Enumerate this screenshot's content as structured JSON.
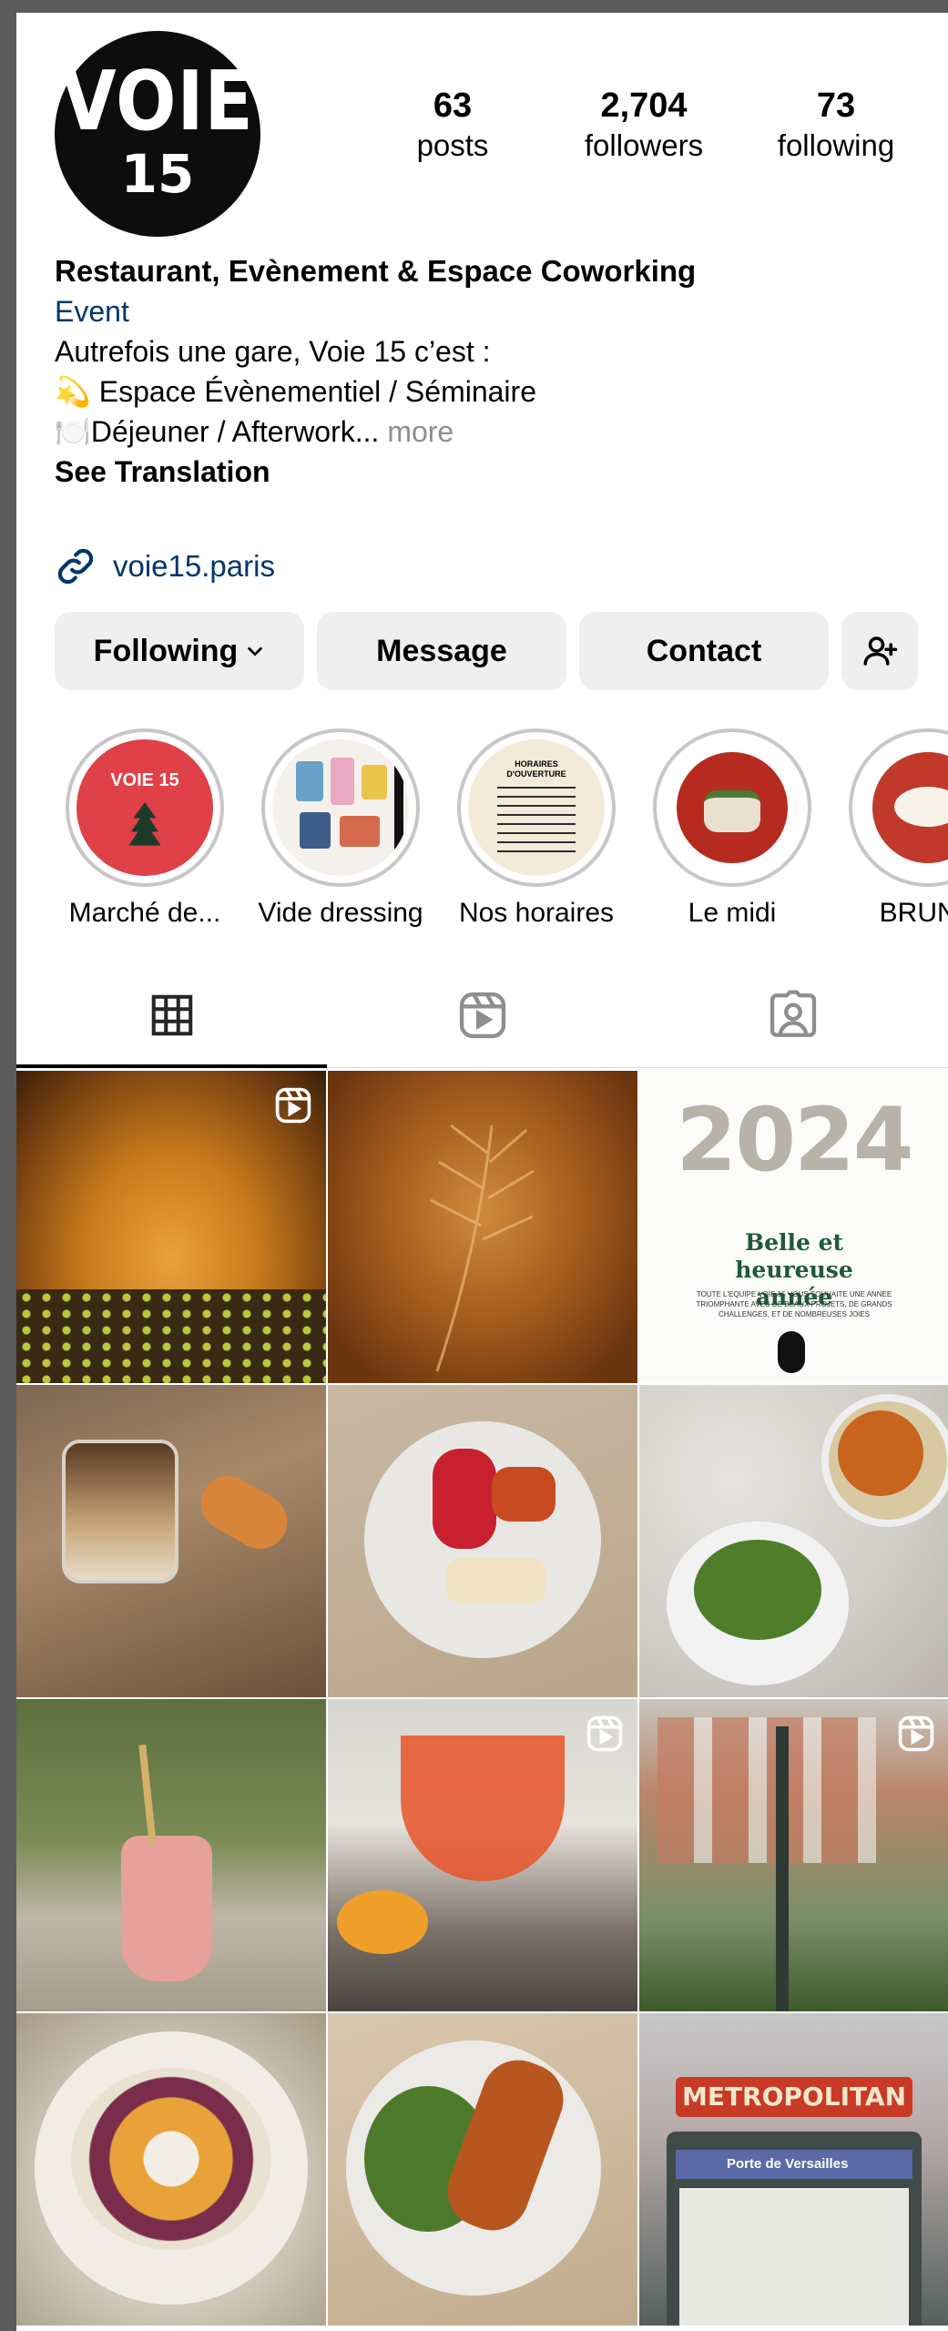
{
  "profile": {
    "avatar_line1": "VOIE",
    "avatar_line2": "15",
    "stats": [
      {
        "num": "63",
        "label": "posts"
      },
      {
        "num": "2,704",
        "label": "followers"
      },
      {
        "num": "73",
        "label": "following"
      }
    ],
    "name": "Restaurant, Evènement & Espace Coworking",
    "category": "Event",
    "bio_line1": "Autrefois une gare, Voie 15 c’est :",
    "bio_line2": "💫 Espace Évènementiel / Séminaire",
    "bio_line3": "🍽️Déjeuner / Afterwork...",
    "more": "more",
    "see_translation": "See Translation",
    "link": "voie15.paris"
  },
  "buttons": {
    "following": "Following",
    "message": "Message",
    "contact": "Contact"
  },
  "highlights": [
    {
      "label": "Marché de...",
      "cover_text": "VOIE 15"
    },
    {
      "label": "Vide dressing"
    },
    {
      "label": "Nos horaires",
      "cover_text": "HORAIRES D'OUVERTURE"
    },
    {
      "label": "Le midi"
    },
    {
      "label": "BRUNC"
    }
  ],
  "tabs": [
    "grid-icon",
    "reels-icon",
    "tagged-icon"
  ],
  "posts": {
    "p3_year": "2024",
    "p3_title": "Belle et heureuse année",
    "p3_sub": "TOUTE L'EQUIPE VOIE 15 VOUS SOUHAITE UNE ANNEE TRIOMPHANTE AVEC DE BEAUX PROJETS, DE GRANDS CHALLENGES, ET DE NOMBREUSES JOIES",
    "p12_sign": "METROPOLITAN",
    "p12_station": "Porte de Versailles"
  },
  "colors": {
    "accent_link": "#00376b",
    "button_bg": "#efefef",
    "muted": "#8e8e8e"
  }
}
